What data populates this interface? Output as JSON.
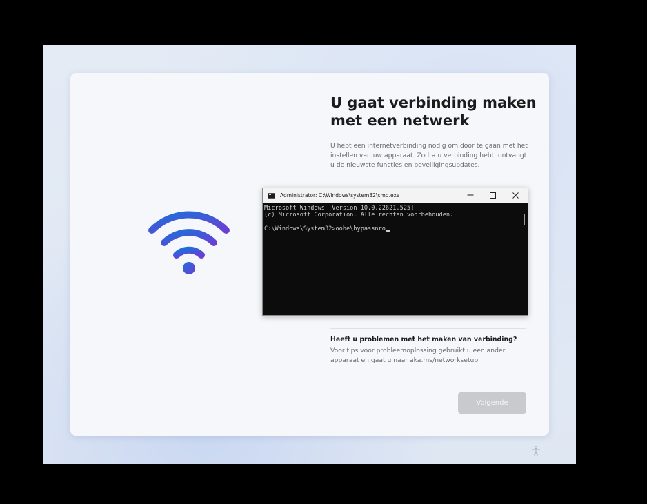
{
  "oobe": {
    "title": "U gaat verbinding maken met een netwerk",
    "description": "U hebt een internetverbinding nodig om door te gaan met het instellen van uw apparaat. Zodra u verbinding hebt, ontvangt u de nieuwste functies en beveiligingsupdates.",
    "help_heading": "Heeft u problemen met het maken van verbinding?",
    "help_text": "Voor tips voor probleemoplossing gebruikt u een ander apparaat en gaat u naar aka.ms/networksetup",
    "next_button_label": "Volgende",
    "next_button_enabled": false,
    "main_icon": "wifi-icon",
    "accessibility_icon": "accessibility-icon",
    "colors": {
      "card_background": "#f6f7fa",
      "disabled_button": "#c8cacd",
      "wifi_gradient_start": "#1e6fd9",
      "wifi_gradient_end": "#6a3fd4"
    }
  },
  "cmd": {
    "title": "Administrator: C:\\Windows\\system32\\cmd.exe",
    "minimize_icon": "minimize-icon",
    "maximize_icon": "maximize-icon",
    "close_icon": "close-icon",
    "lines": [
      "Microsoft Windows [Version 10.0.22621.525]",
      "(c) Microsoft Corporation. Alle rechten voorbehouden.",
      "",
      "C:\\Windows\\System32>oobe\\bypassnro"
    ],
    "colors": {
      "background": "#0c0c0c",
      "text": "#cccccc"
    }
  }
}
